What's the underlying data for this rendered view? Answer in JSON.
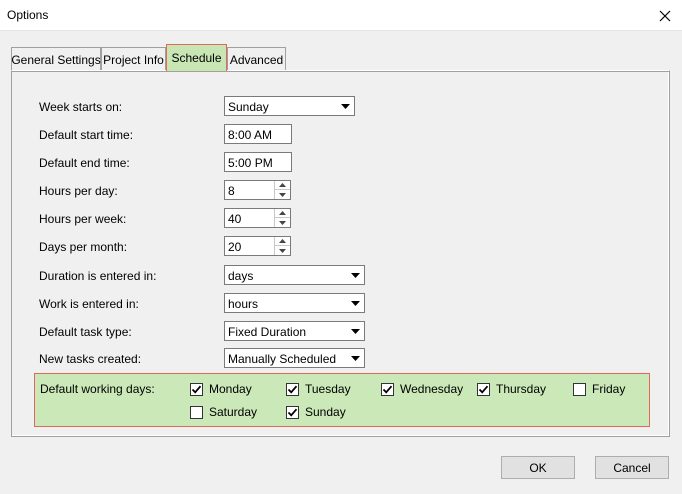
{
  "window": {
    "title": "Options"
  },
  "tabs": [
    {
      "label": "General Settings"
    },
    {
      "label": "Project Info"
    },
    {
      "label": "Schedule"
    },
    {
      "label": "Advanced"
    }
  ],
  "active_tab": "Schedule",
  "schedule": {
    "week_starts_on": {
      "label": "Week starts on:",
      "value": "Sunday"
    },
    "default_start_time": {
      "label": "Default start time:",
      "value": "8:00 AM"
    },
    "default_end_time": {
      "label": "Default end time:",
      "value": "5:00 PM"
    },
    "hours_per_day": {
      "label": "Hours per day:",
      "value": "8"
    },
    "hours_per_week": {
      "label": "Hours per week:",
      "value": "40"
    },
    "days_per_month": {
      "label": "Days per month:",
      "value": "20"
    },
    "duration_entered_in": {
      "label": "Duration is entered in:",
      "value": "days"
    },
    "work_entered_in": {
      "label": "Work is entered in:",
      "value": "hours"
    },
    "default_task_type": {
      "label": "Default task type:",
      "value": "Fixed Duration"
    },
    "new_tasks_created": {
      "label": "New tasks created:",
      "value": "Manually Scheduled"
    }
  },
  "working_days": {
    "label": "Default working days:",
    "days": [
      {
        "name": "Monday",
        "checked": true
      },
      {
        "name": "Tuesday",
        "checked": true
      },
      {
        "name": "Wednesday",
        "checked": true
      },
      {
        "name": "Thursday",
        "checked": true
      },
      {
        "name": "Friday",
        "checked": false
      },
      {
        "name": "Saturday",
        "checked": false
      },
      {
        "name": "Sunday",
        "checked": true
      }
    ]
  },
  "buttons": {
    "ok": "OK",
    "cancel": "Cancel"
  },
  "colors": {
    "highlight_fill": "#c8e6b4",
    "highlight_border": "#e0695a",
    "dialog_background": "#f0f0f0"
  }
}
